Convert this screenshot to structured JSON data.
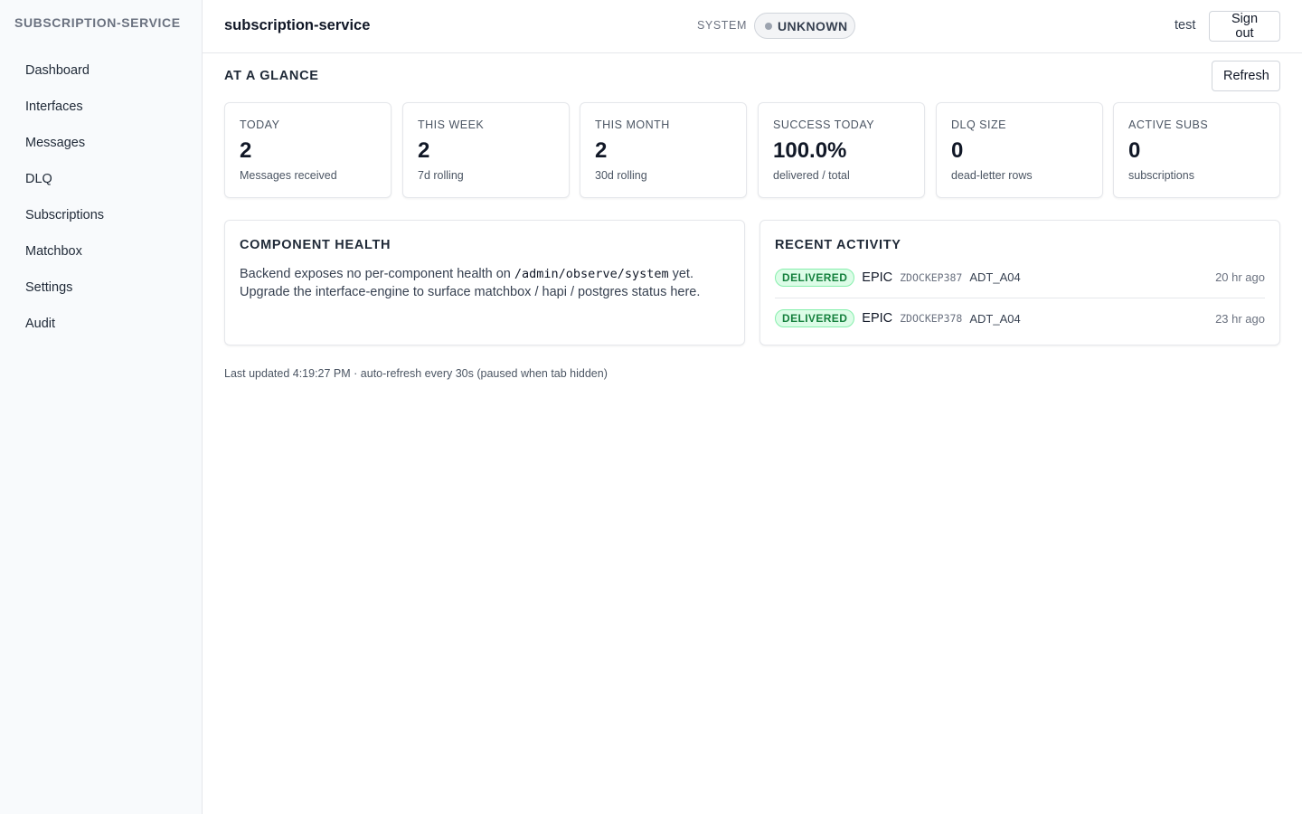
{
  "sidebar": {
    "brand": "SUBSCRIPTION-SERVICE",
    "items": [
      {
        "label": "Dashboard"
      },
      {
        "label": "Interfaces"
      },
      {
        "label": "Messages"
      },
      {
        "label": "DLQ"
      },
      {
        "label": "Subscriptions"
      },
      {
        "label": "Matchbox"
      },
      {
        "label": "Settings"
      },
      {
        "label": "Audit"
      }
    ]
  },
  "header": {
    "title": "subscription-service",
    "system_label": "SYSTEM",
    "system_status": "UNKNOWN",
    "user": "test",
    "signout_label": "Sign out"
  },
  "glance": {
    "title": "AT A GLANCE",
    "refresh_label": "Refresh",
    "stats": [
      {
        "label": "TODAY",
        "value": "2",
        "sub": "Messages received"
      },
      {
        "label": "THIS WEEK",
        "value": "2",
        "sub": "7d rolling"
      },
      {
        "label": "THIS MONTH",
        "value": "2",
        "sub": "30d rolling"
      },
      {
        "label": "SUCCESS TODAY",
        "value": "100.0%",
        "sub": "delivered / total"
      },
      {
        "label": "DLQ SIZE",
        "value": "0",
        "sub": "dead-letter rows"
      },
      {
        "label": "ACTIVE SUBS",
        "value": "0",
        "sub": "subscriptions"
      }
    ]
  },
  "health": {
    "title": "COMPONENT HEALTH",
    "text_before": "Backend exposes no per-component health on ",
    "path": "/admin/observe/system",
    "text_after": " yet. Upgrade the interface-engine to surface matchbox / hapi / postgres status here."
  },
  "activity": {
    "title": "RECENT ACTIVITY",
    "rows": [
      {
        "status": "DELIVERED",
        "sender": "EPIC",
        "id": "ZDOCKEP387",
        "type": "ADT_A04",
        "when": "20 hr ago"
      },
      {
        "status": "DELIVERED",
        "sender": "EPIC",
        "id": "ZDOCKEP378",
        "type": "ADT_A04",
        "when": "23 hr ago"
      }
    ]
  },
  "footer": {
    "text": "Last updated 4:19:27 PM · auto-refresh every 30s (paused when tab hidden)"
  },
  "colors": {
    "delivered": "#15803d",
    "unknown_dot": "#9ca3af"
  }
}
